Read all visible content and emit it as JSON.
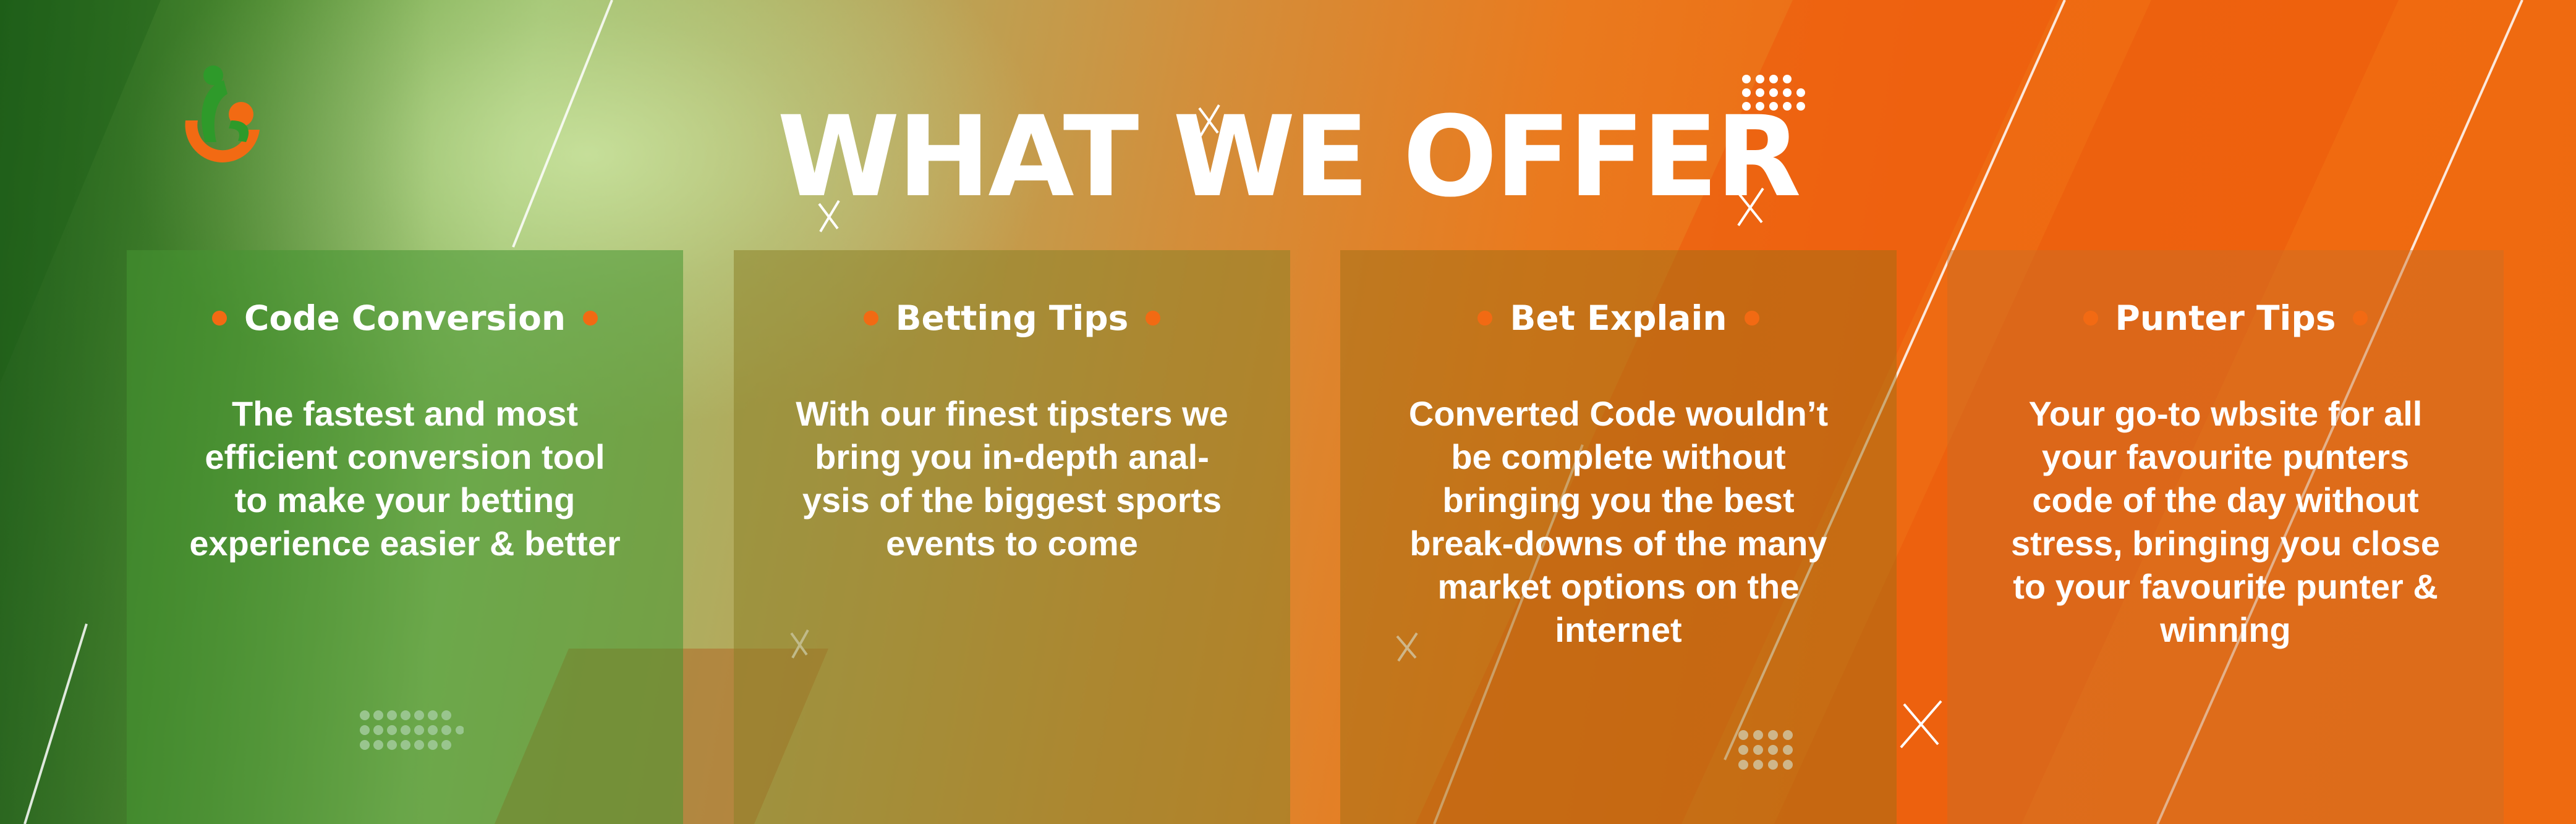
{
  "page": {
    "title": "WHAT WE OFFER",
    "logo": "runner-icon",
    "colors": {
      "green": "#2e7d22",
      "orange": "#f06a10",
      "dot_orange": "#f26a13",
      "text": "#ffffff"
    }
  },
  "cards": [
    {
      "title": "Code Conversion",
      "text": "The fastest and most\nefficient conversion tool\nto make your betting\nexperience easier & better"
    },
    {
      "title": "Betting Tips",
      "text": "With our finest tipsters we\nbring you in-depth anal-\nysis of the biggest sports\nevents to come"
    },
    {
      "title": "Bet Explain",
      "text": "Converted Code wouldn’t\nbe complete without\nbringing you the best\nbreak-downs of the many\nmarket options on the\ninternet"
    },
    {
      "title": "Punter Tips",
      "text": "Your go-to wbsite for all\nyour favourite punters\ncode of the day without\nstress, bringing you close\nto your favourite punter &\nwinning"
    }
  ]
}
